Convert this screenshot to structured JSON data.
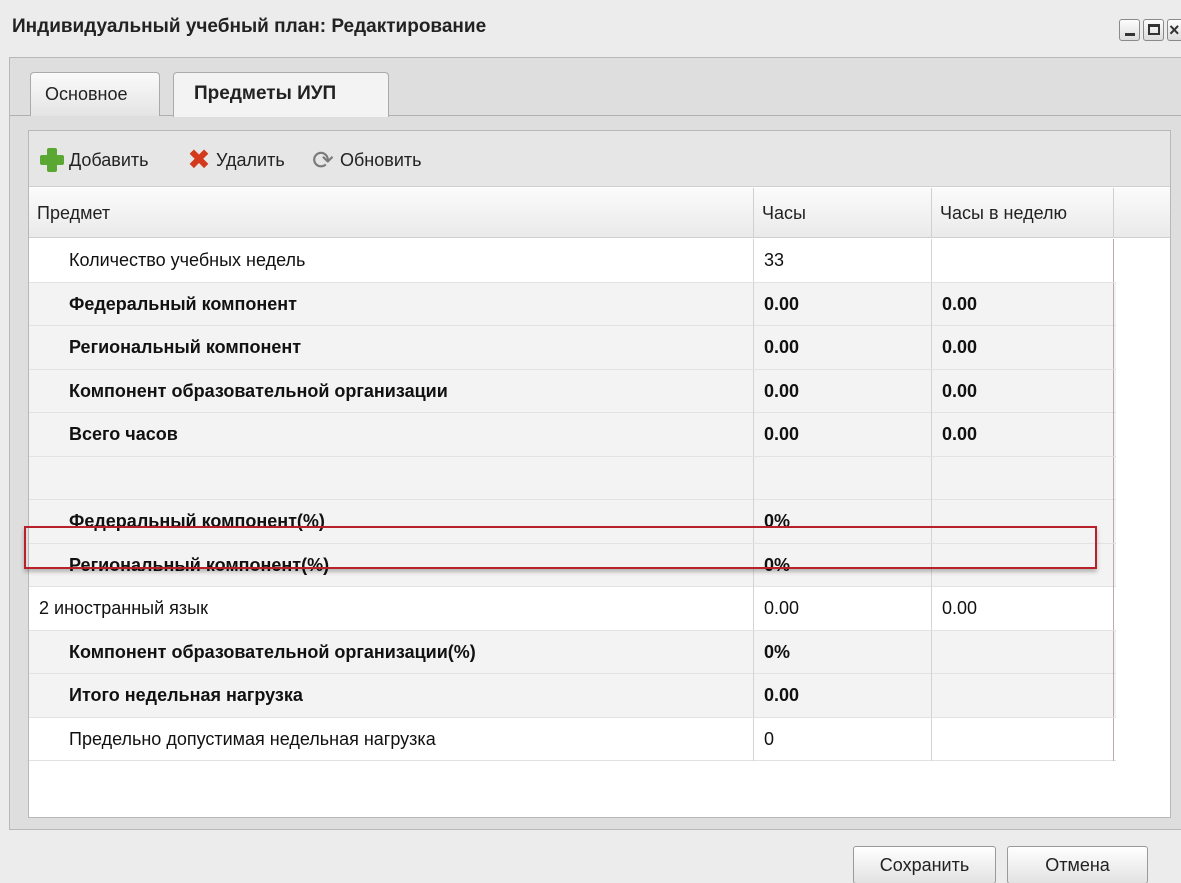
{
  "window": {
    "title": "Индивидуальный учебный план: Редактирование"
  },
  "tabs": [
    {
      "label": "Основное",
      "active": false
    },
    {
      "label": "Предметы ИУП",
      "active": true
    }
  ],
  "toolbar": {
    "add_label": "Добавить",
    "delete_label": "Удалить",
    "refresh_label": "Обновить"
  },
  "table": {
    "columns": [
      "Предмет",
      "Часы",
      "Часы в неделю"
    ],
    "rows": [
      {
        "subject": "Количество учебных недель",
        "hours": "33",
        "per_week": ""
      },
      {
        "subject": "Федеральный компонент",
        "hours": "0.00",
        "per_week": "0.00"
      },
      {
        "subject": "Региональный компонент",
        "hours": "0.00",
        "per_week": "0.00"
      },
      {
        "subject": "Компонент образовательной организации",
        "hours": "0.00",
        "per_week": "0.00"
      },
      {
        "subject": "Всего часов",
        "hours": "0.00",
        "per_week": "0.00"
      },
      {
        "subject": "",
        "hours": "",
        "per_week": ""
      },
      {
        "subject": "Федеральный компонент(%)",
        "hours": "0%",
        "per_week": ""
      },
      {
        "subject": "Региональный компонент(%)",
        "hours": "0%",
        "per_week": ""
      },
      {
        "subject": "2 иностранный язык",
        "hours": "0.00",
        "per_week": "0.00"
      },
      {
        "subject": "Компонент образовательной организации(%)",
        "hours": "0%",
        "per_week": ""
      },
      {
        "subject": "Итого недельная нагрузка",
        "hours": "0.00",
        "per_week": ""
      },
      {
        "subject": "Предельно допустимая недельная нагрузка",
        "hours": "0",
        "per_week": ""
      }
    ]
  },
  "footer": {
    "save_label": "Сохранить",
    "cancel_label": "Отмена"
  },
  "colors": {
    "highlight_border": "#b8202a",
    "add_icon": "#5aa833",
    "delete_icon": "#d33a1c"
  }
}
